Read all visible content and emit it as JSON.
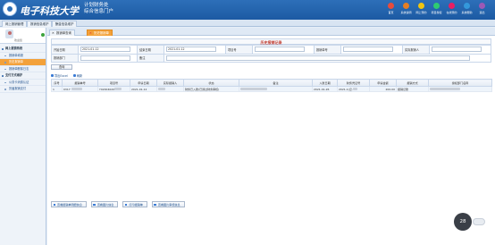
{
  "header": {
    "university": "电子科技大学",
    "system_line1": "计划财务处",
    "system_line2": "综合信息门户",
    "nav": [
      {
        "label": "首页",
        "color": "#e74c3c"
      },
      {
        "label": "系统说明",
        "color": "#e67e22"
      },
      {
        "label": "网上预约",
        "color": "#f1c40f"
      },
      {
        "label": "项目授权",
        "color": "#2ecc71"
      },
      {
        "label": "在线预约",
        "color": "#e91e63"
      },
      {
        "label": "系统帮助",
        "color": "#3498db"
      },
      {
        "label": "退出",
        "color": "#9b59b6"
      }
    ]
  },
  "module_tabs": [
    "网上报销管理",
    "报销信息维护",
    "酬金信息维护"
  ],
  "sidebar": {
    "user_name": "欢迎您",
    "items": [
      {
        "label": "网上报销系统",
        "type": "header"
      },
      {
        "label": "报销单填报",
        "type": "item"
      },
      {
        "label": "历史报销单",
        "type": "active"
      },
      {
        "label": "报销单删除日志",
        "type": "item"
      },
      {
        "label": "支付方式维护",
        "type": "header"
      },
      {
        "label": "公务卡消费认证",
        "type": "item"
      },
      {
        "label": "历届报销支付",
        "type": "item"
      }
    ]
  },
  "page_tabs": [
    {
      "label": "报销单查询",
      "active": false
    },
    {
      "label": "历史报销单",
      "active": true
    }
  ],
  "form": {
    "title": "历史报销记录",
    "start_date_label": "开始日期",
    "start_date": "2021-01-12",
    "end_date_label": "结束日期",
    "end_date": "2021-01-12",
    "project_label": "项目号",
    "reimb_no_label": "报销单号",
    "actual_amount_label": "实际报销人",
    "dept_label": "报销部门",
    "remark_label": "备注",
    "search_btn": "查询"
  },
  "toolbar": {
    "export": "导出Excel",
    "refresh": "刷新"
  },
  "grid": {
    "columns": [
      "序号",
      "报销单号",
      "项目号",
      "申请日期",
      "实际报销人",
      "状态",
      "备注",
      "入账日期",
      "财务凭证号",
      "申请金额",
      "报销方式",
      "授权部门名称"
    ],
    "rows": [
      {
        "no": "1",
        "reimb_no": "0317",
        "project": "Y02004020",
        "apply_date": "2021-01-12",
        "person": "",
        "status": "财务已入账(已通过财务审核)",
        "remark": "",
        "post_date": "2021-01-26",
        "voucher": "2021-1(记-",
        "amount": "200.00",
        "method": "报销记账",
        "dept": ""
      }
    ]
  },
  "bottom_buttons": [
    "查看报销单明细信息",
    "查看图片信息",
    "打印报销单",
    "查看图片审核信息"
  ],
  "bubble_text": "28"
}
